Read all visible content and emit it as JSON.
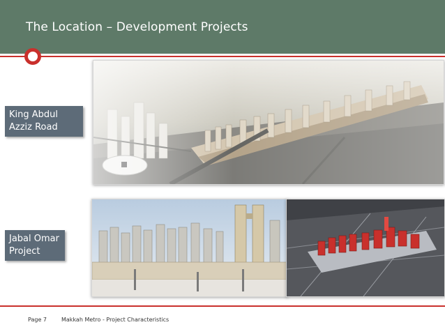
{
  "header": {
    "title": "The Location – Development Projects",
    "accent_color": "#c9302c",
    "bar_color": "#5e7a68"
  },
  "labels": {
    "king_abdul_aziz": "King Abdul Azziz Road",
    "jabal_omar": "Jabal Omar Project"
  },
  "footer": {
    "page": "Page 7",
    "title": "Makkah Metro - Project Characteristics"
  }
}
